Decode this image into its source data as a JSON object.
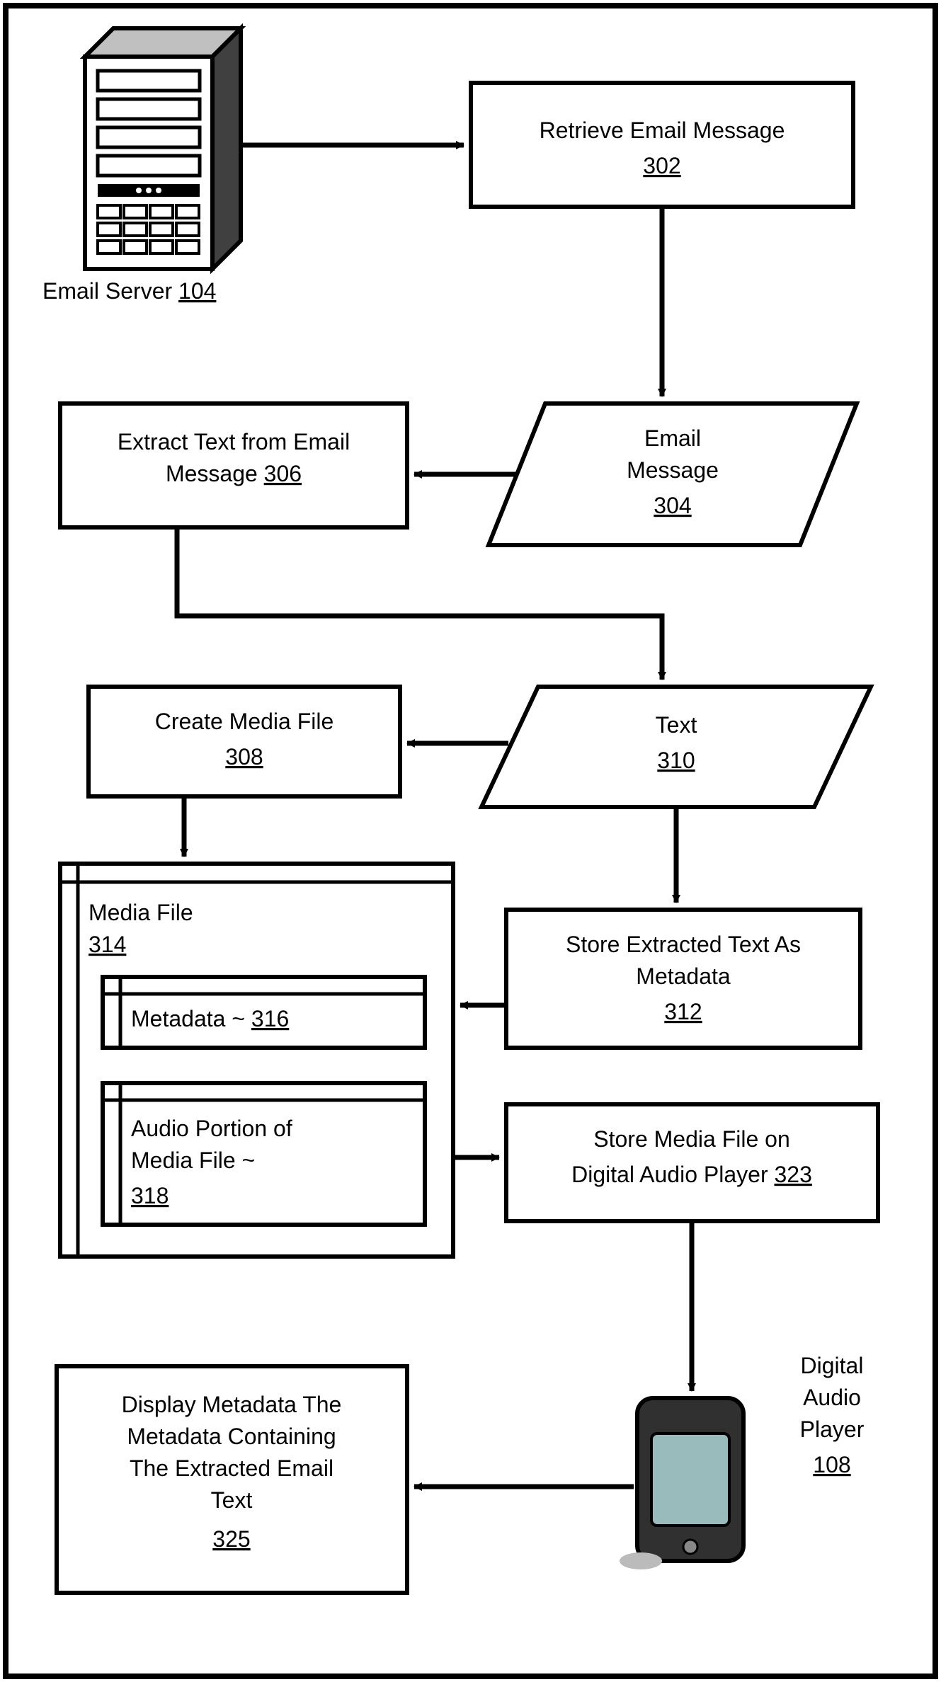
{
  "nodes": {
    "email_server": {
      "label": "Email Server",
      "ref": "104"
    },
    "retrieve_email": {
      "label": "Retrieve Email Message",
      "ref": "302"
    },
    "email_message": {
      "line1": "Email",
      "line2": "Message",
      "ref": "304"
    },
    "extract_text": {
      "line1": "Extract Text from Email",
      "line2": "Message",
      "ref": "306"
    },
    "create_media": {
      "label": "Create Media File",
      "ref": "308"
    },
    "text": {
      "label": "Text",
      "ref": "310"
    },
    "store_text_meta": {
      "line1": "Store Extracted Text As",
      "line2": "Metadata",
      "ref": "312"
    },
    "media_file": {
      "label": "Media File",
      "ref": "314"
    },
    "metadata": {
      "label": "Metadata ~",
      "ref": "316"
    },
    "audio_portion": {
      "line1": "Audio Portion of",
      "line2": "Media File ~",
      "ref": "318"
    },
    "store_media": {
      "line1": "Store Media File on",
      "line2": "Digital Audio Player",
      "ref": "323"
    },
    "display_meta": {
      "l1": "Display Metadata The",
      "l2": "Metadata Containing",
      "l3": "The Extracted Email",
      "l4": "Text",
      "ref": "325"
    },
    "player": {
      "line1": "Digital",
      "line2": "Audio",
      "line3": "Player",
      "ref": "108"
    }
  }
}
